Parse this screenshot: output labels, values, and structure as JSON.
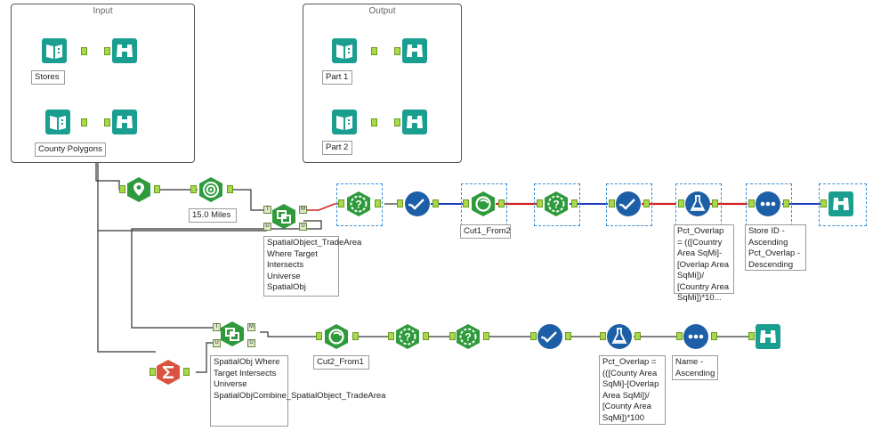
{
  "containers": {
    "input": "Input",
    "output": "Output"
  },
  "annotations": {
    "stores": "Stores",
    "county_polygons": "County Polygons",
    "part1": "Part 1",
    "part2": "Part 2",
    "trade_area": "15.0 Miles",
    "spatial_match_1": "SpatialObject_TradeArea Where Target Intersects Universe SpatialObj",
    "cut1": "Cut1_From2",
    "formula_1": "Pct_Overlap = (([Country Area SqMi]-[Overlap Area SqMi])/ [Country Area SqMi])*10...",
    "sort_1": "Store ID - Ascending Pct_Overlap - Descending",
    "spatial_match_2": "SpatialObj Where Target Intersects Universe SpatialObjCombine_SpatialObject_TradeArea",
    "cut2": "Cut2_From1",
    "formula_2": "Pct_Overlap = (([County Area SqMi]-[Overlap Area SqMi])/ [County Area SqMi])*100",
    "sort_2": "Name - Ascending"
  },
  "anchors": {
    "target": "T",
    "universe": "U",
    "match": "M",
    "unmatched": "U"
  },
  "icons": [
    "input-data-icon",
    "browse-icon",
    "create-points-icon",
    "trade-area-icon",
    "spatial-match-icon",
    "filter-icon",
    "select-icon",
    "spatial-process-icon",
    "formula-icon",
    "sort-icon",
    "summarize-icon"
  ],
  "colors": {
    "in_out": "#1a9e8f",
    "spatial": "#2e9a3c",
    "prep": "#2a6fb0",
    "transform": "#d9533e",
    "wire_true": "#d42020",
    "wire_false": "#1f3fbf",
    "wire": "#333333"
  }
}
